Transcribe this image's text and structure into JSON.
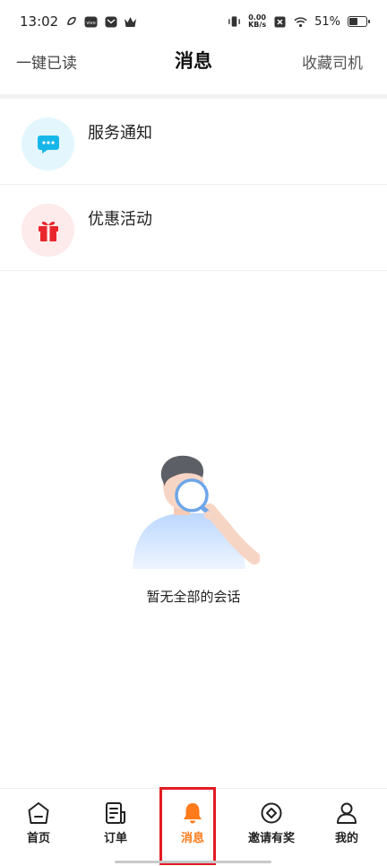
{
  "status_bar": {
    "time": "13:02",
    "net_speed_value": "0.00",
    "net_speed_unit": "KB/s",
    "battery_percent": "51%",
    "battery_level": 0.51
  },
  "header": {
    "mark_all_read": "一键已读",
    "title": "消息",
    "favorite_drivers": "收藏司机"
  },
  "messages": [
    {
      "label": "服务通知",
      "icon": "chat-bubble-icon",
      "icon_color": "#17b6e8",
      "bg_color": "#e3f6fd"
    },
    {
      "label": "优惠活动",
      "icon": "gift-icon",
      "icon_color": "#e8262c",
      "bg_color": "#fdeaea"
    }
  ],
  "empty_state": {
    "text": "暂无全部的会话",
    "illustration": "person-with-magnifier"
  },
  "bottom_nav": {
    "items": [
      {
        "label": "首页",
        "icon": "home-icon"
      },
      {
        "label": "订单",
        "icon": "orders-icon"
      },
      {
        "label": "消息",
        "icon": "bell-icon",
        "active": true
      },
      {
        "label": "邀请有奖",
        "icon": "invite-reward-icon"
      },
      {
        "label": "我的",
        "icon": "profile-icon"
      }
    ],
    "active_color": "#ff7a1a",
    "highlight_color": "#e31b23"
  }
}
